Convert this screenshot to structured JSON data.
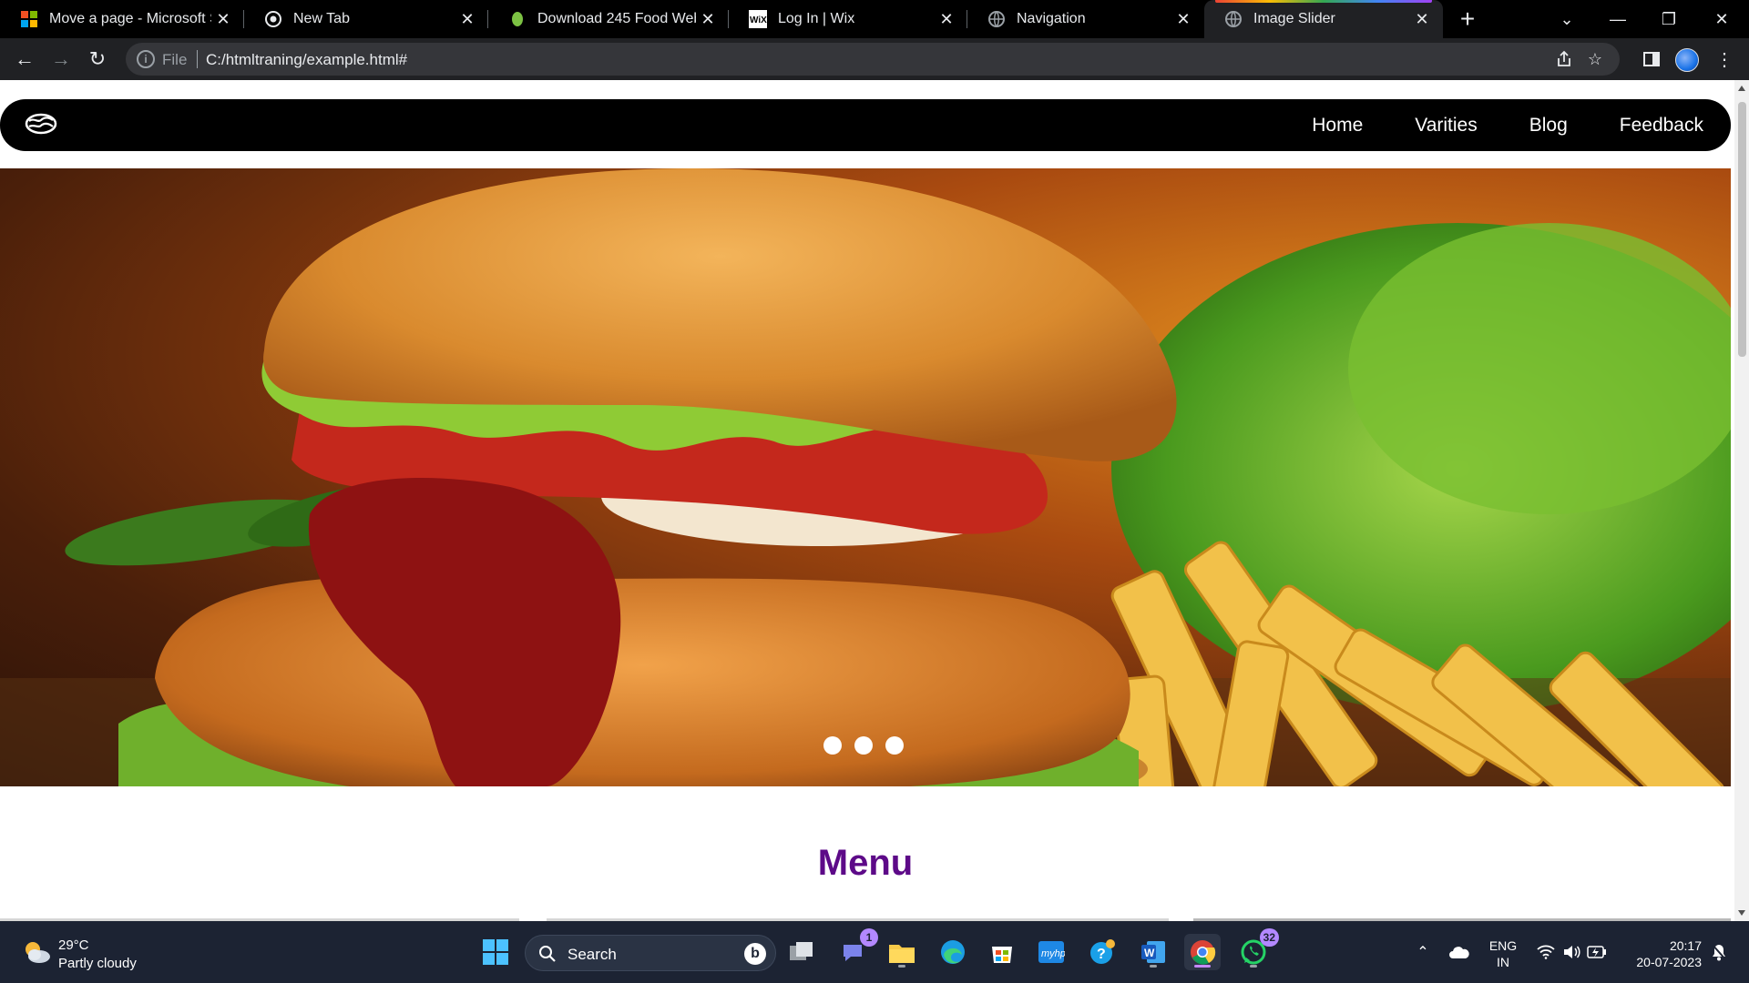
{
  "browser": {
    "tabs": [
      {
        "title": "Move a page - Microsoft Su",
        "icon": "microsoft-icon"
      },
      {
        "title": "New Tab",
        "icon": "chrome-icon"
      },
      {
        "title": "Download 245 Food Web Te",
        "icon": "leaf-icon"
      },
      {
        "title": "Log In | Wix",
        "icon": "wix-icon"
      },
      {
        "title": "Navigation",
        "icon": "globe-icon"
      },
      {
        "title": "Image Slider",
        "icon": "globe-icon",
        "active": true
      }
    ],
    "address_scheme": "File",
    "address_url": "C:/htmltraning/example.html#"
  },
  "site": {
    "nav_links": [
      "Home",
      "Varities",
      "Blog",
      "Feedback"
    ],
    "slider": {
      "slide_count": 3,
      "image": "burger-and-fries"
    },
    "menu_heading": "Menu",
    "colors": {
      "nav_bg": "#000000",
      "heading": "#5d0a88"
    }
  },
  "taskbar": {
    "weather": {
      "temp": "29°C",
      "desc": "Partly cloudy",
      "icon": "partly-cloudy-icon"
    },
    "search_label": "Search",
    "teams_badge": "1",
    "whatsapp_badge": "32",
    "lang_line1": "ENG",
    "lang_line2": "IN",
    "time": "20:17",
    "date": "20-07-2023"
  }
}
